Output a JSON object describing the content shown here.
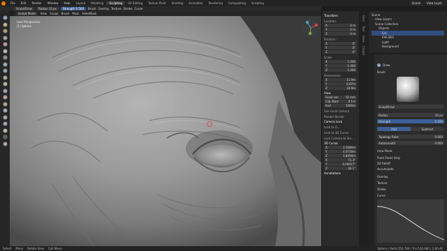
{
  "menubar": {
    "items": [
      "File",
      "Edit",
      "Render",
      "Window",
      "Help"
    ],
    "workspaces": [
      "Layout",
      "Modeling",
      "Sculpting",
      "UV Editing",
      "Texture Paint",
      "Shading",
      "Animation",
      "Rendering",
      "Compositing",
      "Scripting"
    ],
    "scene": "Scene",
    "view_layer": "View Layer"
  },
  "tool_header": {
    "brush_name": "SculptDraw",
    "radius_label": "Radius",
    "radius_value": "10 px",
    "strength_label": "Strength",
    "strength_value": "0.500",
    "menus": [
      "Brush",
      "Overlay",
      "Texture",
      "Stroke",
      "Curve"
    ]
  },
  "view_header": {
    "mode": "Sculpt Mode",
    "menus": [
      "View",
      "Sculpt",
      "Brush",
      "Mask",
      "Hide/Mask"
    ]
  },
  "viewport_info": {
    "line1": "User Perspective",
    "line2": "(1) Sphere"
  },
  "npanel": {
    "transform": "Transform",
    "location": "Location:",
    "rotation": "Rotation:",
    "scale": "Scale:",
    "dimensions": "Dimensions:",
    "x": "X",
    "y": "Y",
    "z": "Z",
    "loc": [
      "0 m",
      "0 m",
      "0 m"
    ],
    "rot": [
      "0°",
      "0°",
      "0°"
    ],
    "scl": [
      "1.000",
      "1.000",
      "1.000"
    ],
    "dim": [
      "11.9m",
      "6.67m",
      "24.9m"
    ],
    "view": "View",
    "focal": "Focal Len",
    "focal_val": "55 mm",
    "clip_start": "Clip Start",
    "clip_start_val": "0.1m",
    "clip_end": "End",
    "clip_end_val": "1000m",
    "local_camera": "Use Local Camera",
    "render_border": "Render Border",
    "camera_lock": "Camera Lock",
    "lock_to": "Lock to O...",
    "lock_cursor": "Lock to 3D Cursor",
    "lock_camera": "Lock Camera to Vie...",
    "cursor_3d": "3D Cursor",
    "cur_loc": [
      "2.5646m",
      "4.0730m",
      "1.8030m"
    ],
    "cur_rot": [
      "71.3°",
      "0.00017°",
      "36.1°"
    ],
    "annotations": "Annotations"
  },
  "side_tabs": [
    "Item",
    "Tool",
    "View",
    "Create"
  ],
  "outliner": {
    "items": [
      "Scene",
      "View Layers",
      "Scene Collection",
      "Objects",
      "Ent",
      "EVE.BES",
      "Light",
      "Background"
    ]
  },
  "properties": {
    "draw": "Draw",
    "brush": "Brush",
    "brush_name": "SculptDraw",
    "radius": "Radius",
    "radius_val": "10 px",
    "strength": "Strength",
    "strength_val": "0.500",
    "add": "Add",
    "subtract": "Subtract",
    "topology": "Topology Rake",
    "topology_val": "0.000",
    "autosmooth": "Autosmooth",
    "autosmooth_val": "0.000",
    "area_plane": "Area Plane",
    "front_faces": "Front Faces Only",
    "falloff": "2D Falloff",
    "accumulate": "Accumulate",
    "overlay": "Overlay",
    "texture": "Texture",
    "stroke": "Stroke",
    "curve": "Curve"
  },
  "statusbar": {
    "select": "Select",
    "move": "Move",
    "rotate": "Rotate View",
    "call_menu": "Call Menu",
    "stats": "Sphere | Verts:250,780 | Tris:524,480 | 2.80.40"
  }
}
